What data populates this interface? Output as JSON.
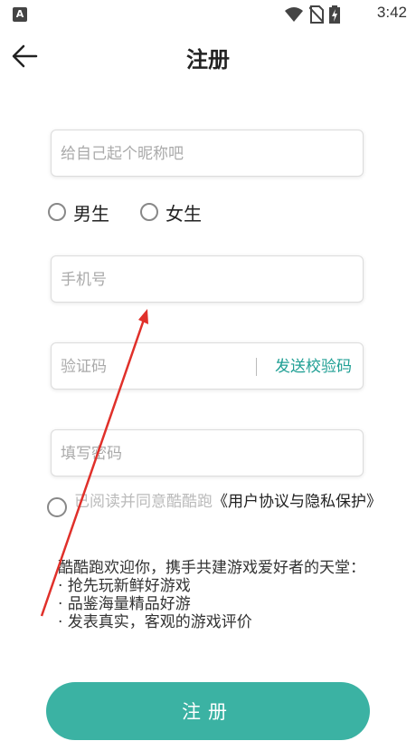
{
  "status_bar": {
    "time": "3:42",
    "app_badge": "A"
  },
  "header": {
    "title": "注册"
  },
  "form": {
    "nickname_placeholder": "给自己起个昵称吧",
    "gender_options": [
      "男生",
      "女生"
    ],
    "phone_placeholder": "手机号",
    "code_placeholder": "验证码",
    "send_code_label": "发送校验码",
    "password_placeholder": "填写密码"
  },
  "agreement": {
    "prefix": "已阅读并同意酷酷跑",
    "link": "《用户协议与隐私保护》"
  },
  "welcome": {
    "intro": "酷酷跑欢迎你，携手共建游戏爱好者的天堂：",
    "bullets": [
      "· 抢先玩新鲜好游戏",
      "· 品鉴海量精品好游",
      "· 发表真实，客观的游戏评价"
    ]
  },
  "actions": {
    "register_label": "注册"
  },
  "colors": {
    "accent": "#3bb2a3",
    "link": "#1f9f94",
    "annotation_arrow": "#e0302a"
  }
}
